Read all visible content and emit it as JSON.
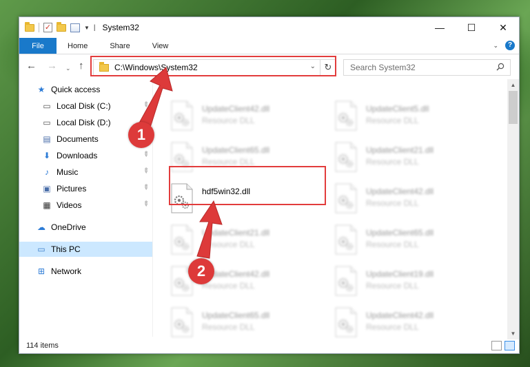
{
  "window": {
    "title": "System32",
    "minimize_glyph": "—",
    "maximize_glyph": "☐",
    "close_glyph": "✕"
  },
  "ribbon": {
    "tabs": [
      "File",
      "Home",
      "Share",
      "View"
    ],
    "expand_glyph": "⌄",
    "help_glyph": "?"
  },
  "address": {
    "path": "C:\\Windows\\System32",
    "dropdown_glyph": "⌄",
    "refresh_glyph": "↻"
  },
  "search": {
    "placeholder": "Search System32"
  },
  "nav_buttons": {
    "back": "←",
    "forward": "→",
    "recent": "⌄",
    "up": "↑"
  },
  "navpane": {
    "items": [
      {
        "label": "Quick access",
        "icon": "star-icon",
        "level": 0,
        "pinned": false
      },
      {
        "label": "Local Disk (C:)",
        "icon": "drive-icon",
        "level": 1,
        "pinned": true
      },
      {
        "label": "Local Disk (D:)",
        "icon": "drive-icon",
        "level": 1,
        "pinned": true
      },
      {
        "label": "Documents",
        "icon": "documents-icon",
        "level": 1,
        "pinned": true
      },
      {
        "label": "Downloads",
        "icon": "downloads-icon",
        "level": 1,
        "pinned": true
      },
      {
        "label": "Music",
        "icon": "music-icon",
        "level": 1,
        "pinned": true
      },
      {
        "label": "Pictures",
        "icon": "pictures-icon",
        "level": 1,
        "pinned": true
      },
      {
        "label": "Videos",
        "icon": "videos-icon",
        "level": 1,
        "pinned": true
      },
      {
        "label": "OneDrive",
        "icon": "cloud-icon",
        "level": 0,
        "pinned": false
      },
      {
        "label": "This PC",
        "icon": "computer-icon",
        "level": 0,
        "pinned": false,
        "selected": true
      },
      {
        "label": "Network",
        "icon": "network-icon",
        "level": 0,
        "pinned": false
      }
    ]
  },
  "files": [
    {
      "name": "UpdateClient42.dll",
      "type": "Resource DLL",
      "blurred": true
    },
    {
      "name": "UpdateClient5.dll",
      "type": "Resource DLL",
      "blurred": true
    },
    {
      "name": "UpdateClient65.dll",
      "type": "Resource DLL",
      "blurred": true
    },
    {
      "name": "UpdateClient21.dll",
      "type": "Resource DLL",
      "blurred": true
    },
    {
      "name": "hdf5win32.dll",
      "type": "",
      "blurred": false
    },
    {
      "name": "UpdateClient42.dll",
      "type": "Resource DLL",
      "blurred": true
    },
    {
      "name": "UpdateClient21.dll",
      "type": "Resource DLL",
      "blurred": true
    },
    {
      "name": "UpdateClient65.dll",
      "type": "Resource DLL",
      "blurred": true
    },
    {
      "name": "UpdateClient42.dll",
      "type": "Resource DLL",
      "blurred": true
    },
    {
      "name": "UpdateClient19.dll",
      "type": "Resource DLL",
      "blurred": true
    },
    {
      "name": "UpdateClient65.dll",
      "type": "Resource DLL",
      "blurred": true
    },
    {
      "name": "UpdateClient42.dll",
      "type": "Resource DLL",
      "blurred": true
    }
  ],
  "status": {
    "item_count": "114 items"
  },
  "scroll": {
    "up_glyph": "▲",
    "down_glyph": "▼"
  },
  "annotations": {
    "step1": "1",
    "step2": "2",
    "color": "#dd3a3a"
  },
  "pin_glyph": "📌"
}
